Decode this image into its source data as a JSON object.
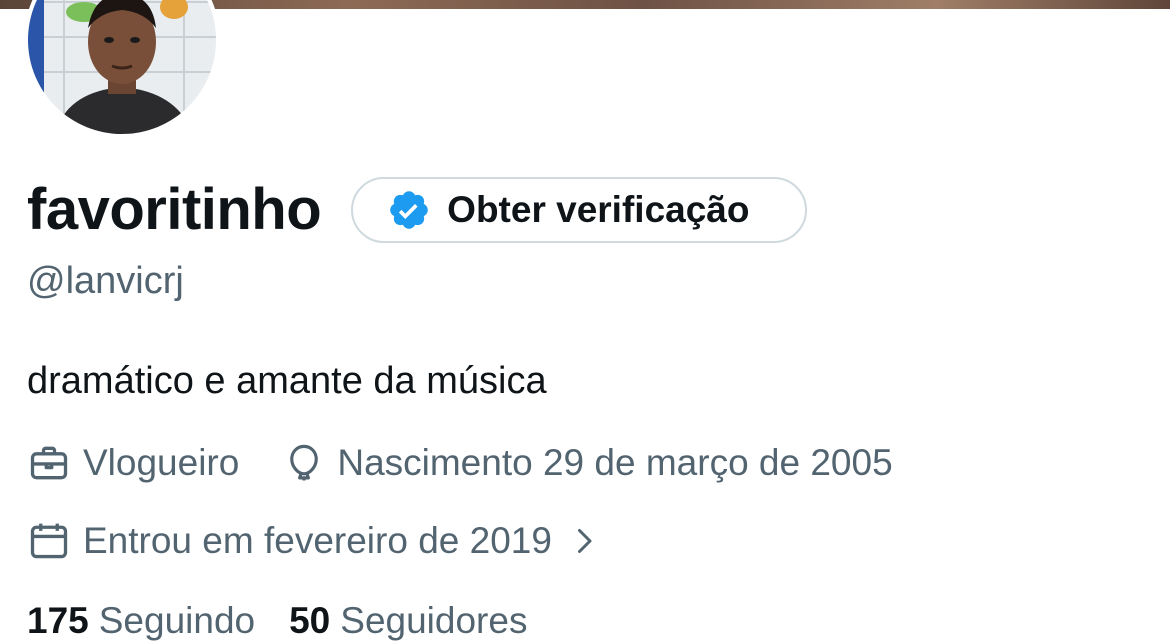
{
  "profile": {
    "display_name": "favoritinho",
    "verify_button_label": "Obter verificação",
    "handle": "@lanvicrj",
    "bio": "dramático e amante da música",
    "profession": "Vlogueiro",
    "birth": "Nascimento 29 de março de 2005",
    "joined": "Entrou em fevereiro de 2019",
    "following_count": "175",
    "following_label": "Seguindo",
    "followers_count": "50",
    "followers_label": "Seguidores"
  },
  "icons": {
    "verified": "verified-badge-icon",
    "profession": "briefcase-icon",
    "birth": "balloon-icon",
    "joined": "calendar-icon",
    "chevron": "chevron-right-icon"
  },
  "colors": {
    "text_primary": "#0f1419",
    "text_secondary": "#536471",
    "verified_blue": "#1d9bf0",
    "button_border": "#cfd9de"
  }
}
